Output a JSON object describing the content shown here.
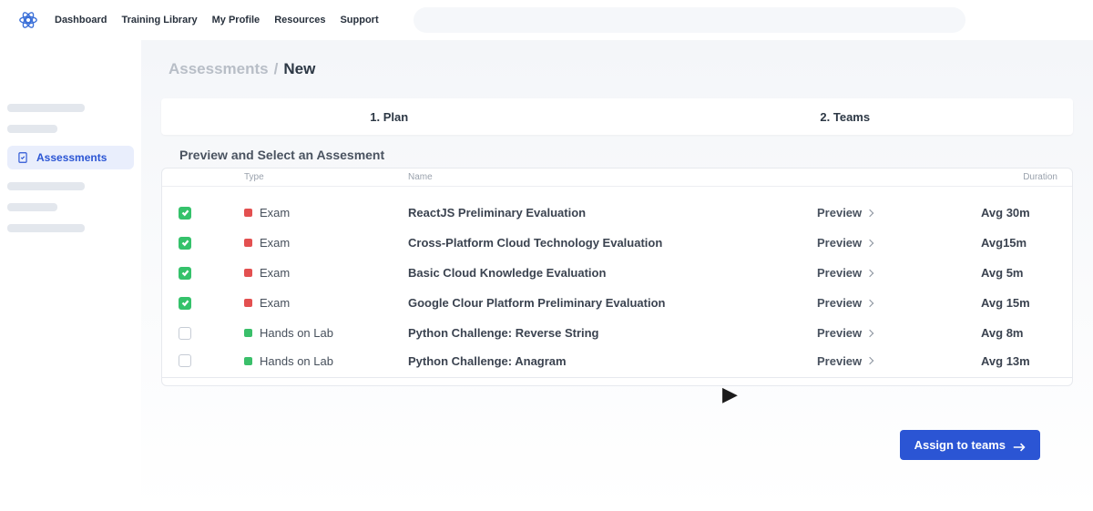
{
  "nav": {
    "links": [
      "Dashboard",
      "Training Library",
      "My Profile",
      "Resources",
      "Support"
    ],
    "search_placeholder": ""
  },
  "sidebar": {
    "active_label": "Assessments"
  },
  "breadcrumb": {
    "parent": "Assessments",
    "separator": "/",
    "current": "New"
  },
  "steps": {
    "plan": "1. Plan",
    "teams": "2. Teams"
  },
  "panel": {
    "title": "Preview and Select an Assesment",
    "headers": {
      "type": "Type",
      "name": "Name",
      "duration": "Duration"
    },
    "preview_label": "Preview"
  },
  "rows": [
    {
      "selected": true,
      "type": "Exam",
      "type_color": "exam",
      "name": "ReactJS Preliminary Evaluation",
      "duration": "Avg 30m"
    },
    {
      "selected": true,
      "type": "Exam",
      "type_color": "exam",
      "name": "Cross-Platform Cloud Technology Evaluation",
      "duration": "Avg15m"
    },
    {
      "selected": true,
      "type": "Exam",
      "type_color": "exam",
      "name": "Basic Cloud Knowledge Evaluation",
      "duration": "Avg  5m"
    },
    {
      "selected": true,
      "type": "Exam",
      "type_color": "exam",
      "name": "Google Clour Platform Preliminary Evaluation",
      "duration": "Avg  15m"
    },
    {
      "selected": false,
      "type": "Hands on Lab",
      "type_color": "lab",
      "name": "Python Challenge: Reverse String",
      "duration": "Avg   8m"
    },
    {
      "selected": false,
      "type": "Hands on Lab",
      "type_color": "lab",
      "name": "Python Challenge: Anagram",
      "duration": "Avg  13m"
    }
  ],
  "actions": {
    "assign": "Assign to teams"
  }
}
